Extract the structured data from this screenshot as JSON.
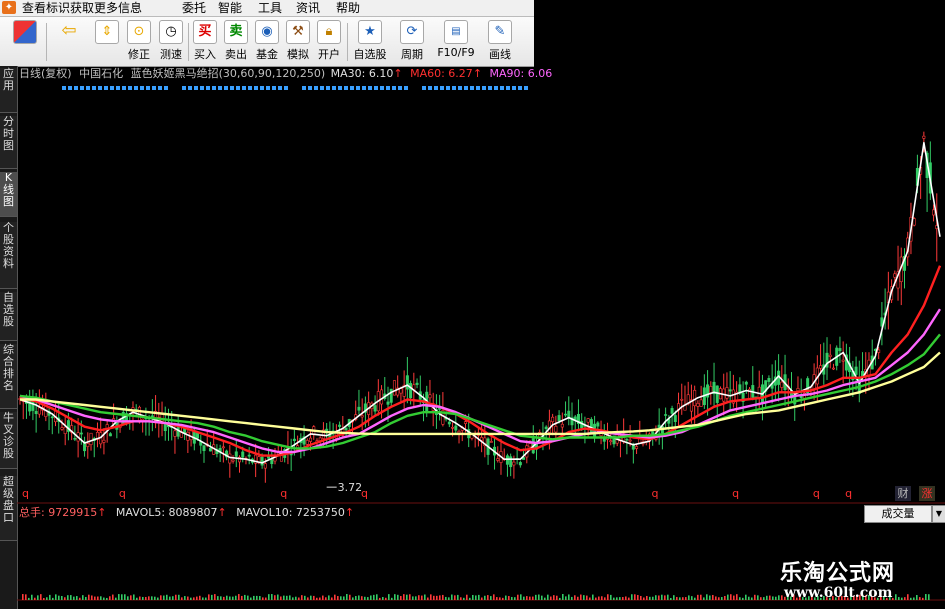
{
  "menubar": {
    "info_link": "查看标识获取更多信息",
    "items": [
      "委托",
      "智能",
      "工具",
      "资讯",
      "帮助"
    ]
  },
  "toolbar": {
    "buttons": [
      {
        "label": "",
        "icon": "grid-icon"
      },
      {
        "label": "",
        "icon": "back-arrow-icon"
      },
      {
        "label": "",
        "icon": "up-down-icon"
      },
      {
        "label": "修正",
        "icon": "revise-icon"
      },
      {
        "label": "测速",
        "icon": "clock-icon"
      },
      {
        "label": "买入",
        "icon": "buy-icon",
        "glyph": "买"
      },
      {
        "label": "卖出",
        "icon": "sell-icon",
        "glyph": "卖"
      },
      {
        "label": "基金",
        "icon": "fund-icon"
      },
      {
        "label": "模拟",
        "icon": "hammer-icon"
      },
      {
        "label": "开户",
        "icon": "lock-icon"
      },
      {
        "label": "自选股",
        "icon": "star-icon"
      },
      {
        "label": "周期",
        "icon": "cycle-icon"
      },
      {
        "label": "F10/F9",
        "icon": "f10-icon"
      },
      {
        "label": "画线",
        "icon": "pen-icon"
      }
    ]
  },
  "sidebar": {
    "tabs": [
      "应用",
      "分时图",
      "K线图",
      "个股资料",
      "自选股",
      "综合排名",
      "牛叉诊股",
      "超级盘口"
    ],
    "active_index": 2
  },
  "chart_header": {
    "period": "日线(复权)",
    "stock": "中国石化",
    "indicator": "蓝色妖姬黑马绝招(30,60,90,120,250)",
    "ma30": "MA30: 6.10",
    "ma60": "MA60: 6.27",
    "ma90": "MA90: 6.06",
    "colors": {
      "period": "#c0c0c0",
      "stock": "#c0c0c0",
      "indicator": "#c0c0c0",
      "ma30": "#e0e0e0",
      "ma60": "#ff3030",
      "ma90": "#ff66ff",
      "arrow": "#ff3030"
    }
  },
  "chart_data": {
    "type": "line",
    "series": [
      {
        "values": [
          2.5,
          2.35,
          2.1,
          1.7,
          1.3,
          1.45,
          1.9,
          2.15,
          2.0,
          1.85,
          1.6,
          1.4,
          1.15,
          0.9,
          0.85,
          0.75,
          0.95,
          1.25,
          1.55,
          1.5,
          1.7,
          2.05,
          2.4,
          2.7,
          2.9,
          2.55,
          2.1,
          1.85,
          1.55,
          1.2,
          0.85,
          0.85,
          1.3,
          1.8,
          2.0,
          1.8,
          1.6,
          1.4,
          1.25,
          1.35,
          1.9,
          2.3,
          2.55,
          2.7,
          2.6,
          2.75,
          2.65,
          3.15,
          2.65,
          2.85,
          3.5,
          3.8,
          2.95,
          3.7,
          5.5,
          6.6,
          9.6,
          7.0
        ],
        "color": "#ffffff"
      },
      {
        "values": [
          2.55,
          2.45,
          2.25,
          2.0,
          1.75,
          1.65,
          1.75,
          1.9,
          1.9,
          1.85,
          1.75,
          1.6,
          1.45,
          1.3,
          1.1,
          0.95,
          0.95,
          1.05,
          1.25,
          1.4,
          1.55,
          1.75,
          2.05,
          2.3,
          2.5,
          2.45,
          2.3,
          2.1,
          1.85,
          1.55,
          1.3,
          1.1,
          1.15,
          1.35,
          1.6,
          1.7,
          1.65,
          1.55,
          1.45,
          1.4,
          1.55,
          1.8,
          2.05,
          2.3,
          2.45,
          2.5,
          2.55,
          2.7,
          2.7,
          2.75,
          2.9,
          3.1,
          3.1,
          3.2,
          3.8,
          4.3,
          5.1,
          6.2
        ],
        "color": "#ff2020"
      },
      {
        "values": [
          2.6,
          2.5,
          2.35,
          2.2,
          2.05,
          1.95,
          1.9,
          1.9,
          1.9,
          1.85,
          1.8,
          1.7,
          1.6,
          1.45,
          1.3,
          1.15,
          1.05,
          1.05,
          1.15,
          1.3,
          1.45,
          1.55,
          1.8,
          2.05,
          2.25,
          2.35,
          2.3,
          2.15,
          1.95,
          1.75,
          1.55,
          1.35,
          1.3,
          1.35,
          1.45,
          1.55,
          1.6,
          1.55,
          1.5,
          1.45,
          1.5,
          1.6,
          1.8,
          2.0,
          2.2,
          2.3,
          2.4,
          2.5,
          2.6,
          2.65,
          2.75,
          2.9,
          3.0,
          3.1,
          3.45,
          3.8,
          4.3,
          5.0
        ],
        "color": "#ff66ff"
      },
      {
        "values": [
          2.6,
          2.55,
          2.45,
          2.35,
          2.25,
          2.15,
          2.1,
          2.05,
          2.0,
          1.95,
          1.9,
          1.85,
          1.75,
          1.6,
          1.5,
          1.35,
          1.25,
          1.15,
          1.15,
          1.2,
          1.3,
          1.45,
          1.6,
          1.85,
          2.05,
          2.15,
          2.15,
          2.1,
          1.95,
          1.8,
          1.65,
          1.5,
          1.45,
          1.4,
          1.45,
          1.45,
          1.45,
          1.45,
          1.5,
          1.5,
          1.55,
          1.65,
          1.75,
          1.9,
          2.05,
          2.15,
          2.25,
          2.35,
          2.45,
          2.55,
          2.65,
          2.75,
          2.85,
          3.0,
          3.2,
          3.45,
          3.75,
          4.3
        ],
        "color": "#33cc33"
      },
      {
        "values": [
          2.5,
          2.5,
          2.45,
          2.4,
          2.35,
          2.3,
          2.25,
          2.2,
          2.15,
          2.1,
          2.05,
          2.0,
          1.95,
          1.9,
          1.85,
          1.8,
          1.75,
          1.7,
          1.65,
          1.6,
          1.58,
          1.56,
          1.55,
          1.55,
          1.55,
          1.55,
          1.55,
          1.55,
          1.55,
          1.55,
          1.55,
          1.55,
          1.55,
          1.55,
          1.55,
          1.55,
          1.58,
          1.6,
          1.62,
          1.65,
          1.7,
          1.75,
          1.8,
          1.9,
          2.0,
          2.1,
          2.15,
          2.2,
          2.3,
          2.4,
          2.5,
          2.6,
          2.7,
          2.85,
          3.0,
          3.2,
          3.4,
          3.8
        ],
        "color": "#ffff99"
      }
    ],
    "low_label": "3.72",
    "low_point": {
      "x": 19,
      "y": 0.3
    },
    "ylim": [
      0,
      11
    ],
    "signal_marks": [
      "q",
      "q",
      "q",
      "q",
      "q",
      "q",
      "q",
      "q"
    ],
    "signal_x": [
      0,
      6,
      16,
      21,
      39,
      44,
      49,
      51
    ]
  },
  "volume": {
    "label_total": "总手: 9729915",
    "label_mavol5": "MAVOL5: 8089807",
    "label_mavol10": "MAVOL10: 7253750",
    "button": "成交量",
    "colors": {
      "total": "#ff6060",
      "mavol5": "#e0e0e0",
      "mavol10": "#e0e0e0"
    }
  },
  "finance_tags": [
    "财",
    "涨"
  ],
  "watermark": {
    "title": "乐淘公式网",
    "url": "www.60lt.com"
  }
}
